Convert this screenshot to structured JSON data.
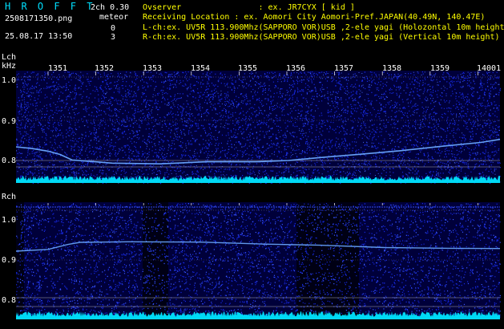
{
  "header": {
    "app_title": "H R O F F T",
    "filename": "2508171350.png",
    "datetime": "25.08.17 13:50",
    "channel_mode": "2ch 0.30",
    "meteor_label": "meteor",
    "meteor_count_l": "0",
    "meteor_count_r": "3",
    "observer_line": "Ovserver                : ex. JR7CYX [ kid ]",
    "location_line": "Receiving Location : ex. Aomori City Aomori-Pref.JAPAN(40.49N, 140.47E)",
    "lch_line": "L-ch:ex. UV5R 113.900Mhz(SAPPORO VOR)USB ,2-ele yagi (Holozontal 10m height",
    "rch_line": "R-ch:ex. UV5R 113.900Mhz(SAPPORO VOR)USB ,2-ele yagi (Vertical 10m height)"
  },
  "panels": {
    "lch": {
      "label": "Lch",
      "unit": "kHz",
      "y_labels": [
        "1.0",
        "0.9",
        "0.8"
      ]
    },
    "rch": {
      "label": "Rch",
      "y_labels": [
        "1.0",
        "0.9",
        "0.8"
      ]
    }
  },
  "time_axis": {
    "ticks": [
      "1351",
      "1352",
      "1353",
      "1354",
      "1355",
      "1356",
      "1357",
      "1358",
      "1359",
      "14001"
    ]
  },
  "colors": {
    "background": "#000000",
    "text_yellow": "#ffff00",
    "text_white": "#ffffff",
    "text_green": "#00ff44",
    "spectrum_noise": "#1a2fff",
    "signal_trace": "#6aa8ff",
    "level_meter": "#00e5ff",
    "guide_lines": "#c0c0c0"
  }
}
